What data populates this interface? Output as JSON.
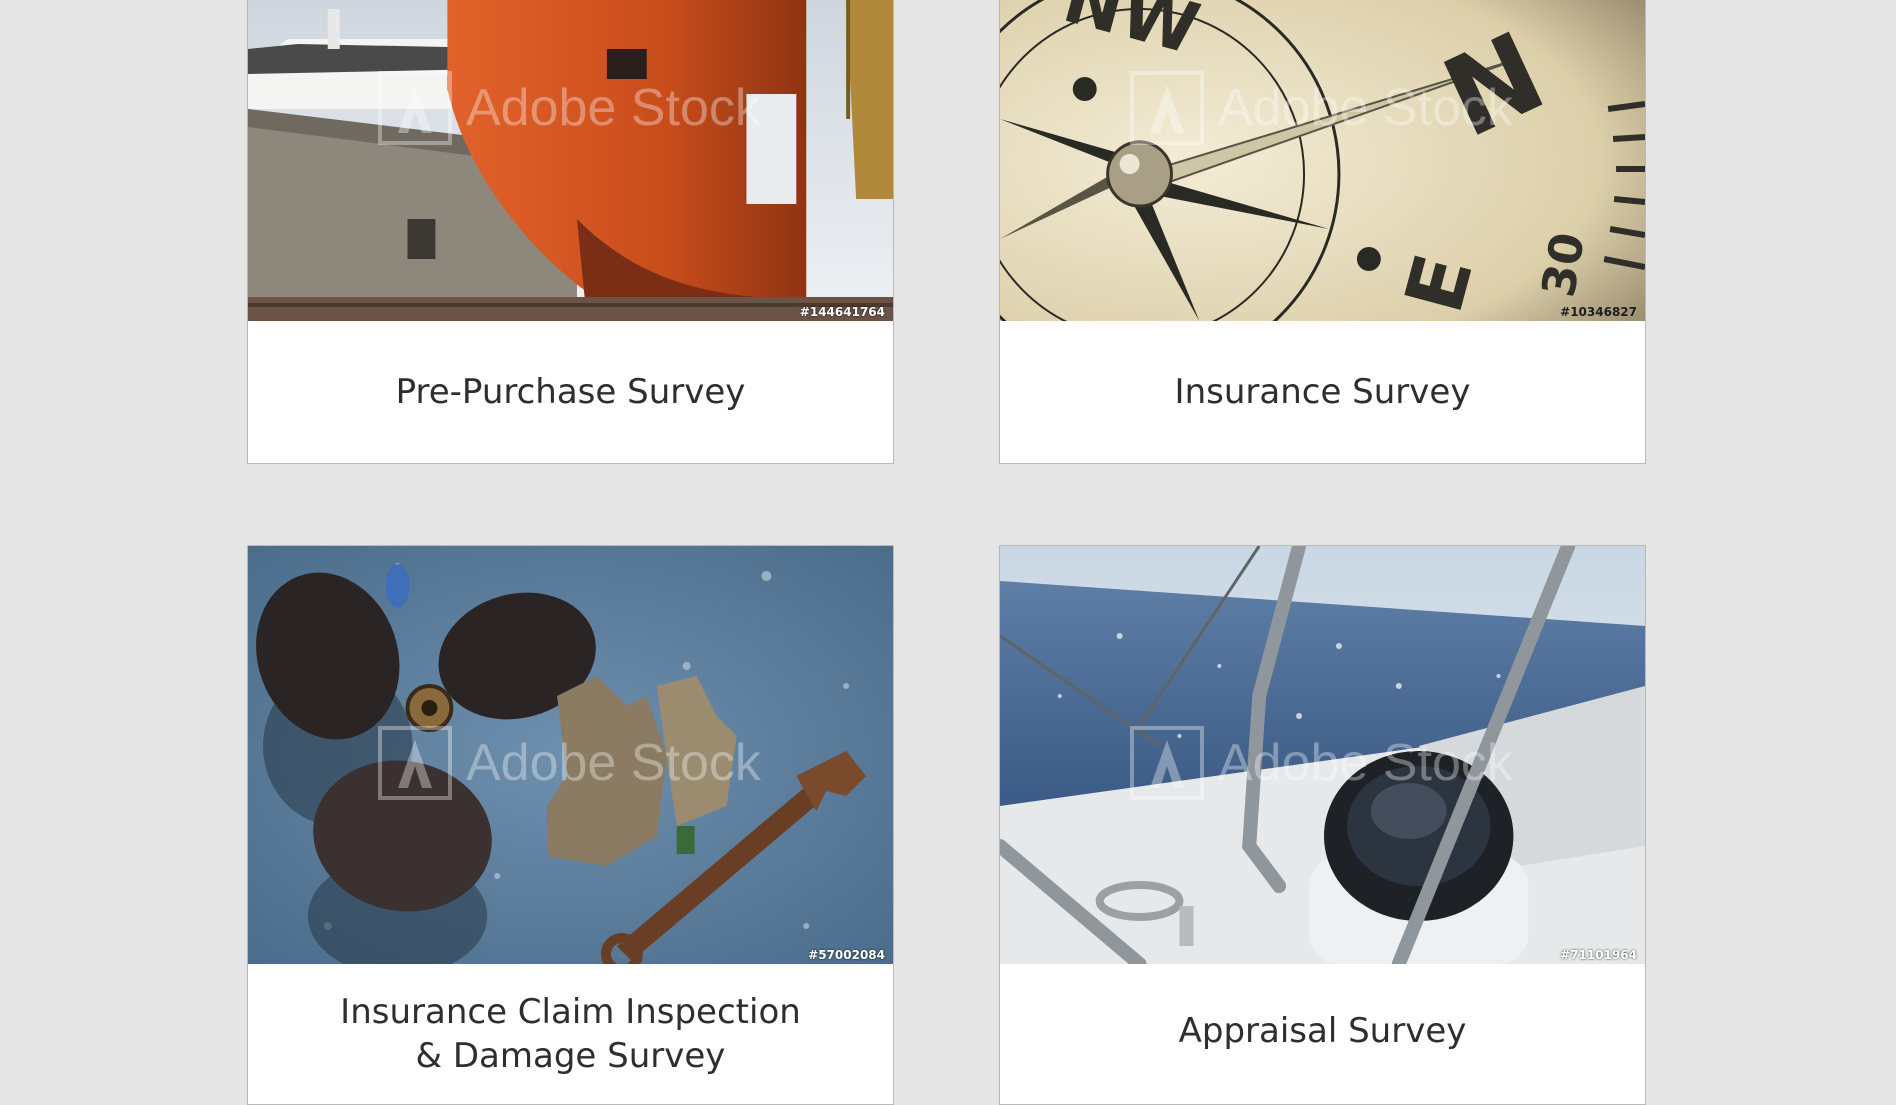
{
  "cards": [
    {
      "title": "Pre-Purchase Survey",
      "stock_id": "#144641764",
      "watermark": "Adobe Stock",
      "image_subject": "ship-in-drydock"
    },
    {
      "title": "Insurance Survey",
      "stock_id": "#10346827",
      "watermark": "Adobe Stock",
      "image_subject": "compass-closeup"
    },
    {
      "title_line1": "Insurance Claim Inspection",
      "title_line2": "& Damage Survey",
      "stock_id": "#57002084",
      "watermark": "Adobe Stock",
      "image_subject": "propeller-gloves-wrench"
    },
    {
      "title": "Appraisal Survey",
      "stock_id": "#71101964",
      "watermark": "Adobe Stock",
      "image_subject": "sailboat-deck-compass"
    }
  ],
  "colors": {
    "page_background": "#e5e5e5",
    "card_background": "#ffffff",
    "card_border": "#b9b9b9",
    "caption_text": "#2e2e2e"
  }
}
